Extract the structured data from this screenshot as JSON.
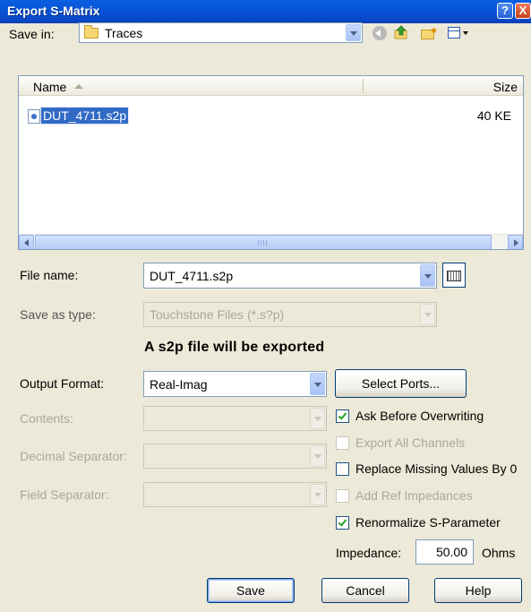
{
  "window": {
    "title": "Export S-Matrix",
    "help_glyph": "?",
    "close_glyph": "X"
  },
  "save_in": {
    "label": "Save in:",
    "value": "Traces"
  },
  "file_list": {
    "columns": [
      "Name",
      "Size"
    ],
    "rows": [
      {
        "name": "DUT_4711.s2p",
        "size": "40 KE"
      }
    ],
    "scroll_grip": "III"
  },
  "file_name": {
    "label": "File name:",
    "value": "DUT_4711.s2p"
  },
  "save_as_type": {
    "label": "Save as type:",
    "value": "Touchstone Files (*.s?p)"
  },
  "info_text": "A s2p file will be exported",
  "output_format": {
    "label": "Output Format:",
    "value": "Real-Imag"
  },
  "contents": {
    "label": "Contents:",
    "value": ""
  },
  "decimal_separator": {
    "label": "Decimal Separator:",
    "value": ""
  },
  "field_separator": {
    "label": "Field Separator:",
    "value": ""
  },
  "select_ports_label": "Select Ports...",
  "options": {
    "ask_before_overwriting": {
      "label": "Ask Before Overwriting",
      "checked": true,
      "enabled": true
    },
    "export_all_channels": {
      "label": "Export All Channels",
      "checked": false,
      "enabled": false
    },
    "replace_missing": {
      "label": "Replace Missing Values By 0",
      "checked": false,
      "enabled": true
    },
    "add_ref_impedances": {
      "label": "Add Ref Impedances",
      "checked": false,
      "enabled": false
    },
    "renormalize": {
      "label": "Renormalize S-Parameter",
      "checked": true,
      "enabled": true
    }
  },
  "impedance": {
    "label": "Impedance:",
    "value": "50.00",
    "unit": "Ohms"
  },
  "buttons": {
    "save": "Save",
    "cancel": "Cancel",
    "help": "Help"
  },
  "icons": [
    "folder-icon",
    "back-icon",
    "up-folder-icon",
    "new-folder-icon",
    "views-menu-icon",
    "file-icon",
    "keyboard-icon",
    "checkmark-icon"
  ]
}
